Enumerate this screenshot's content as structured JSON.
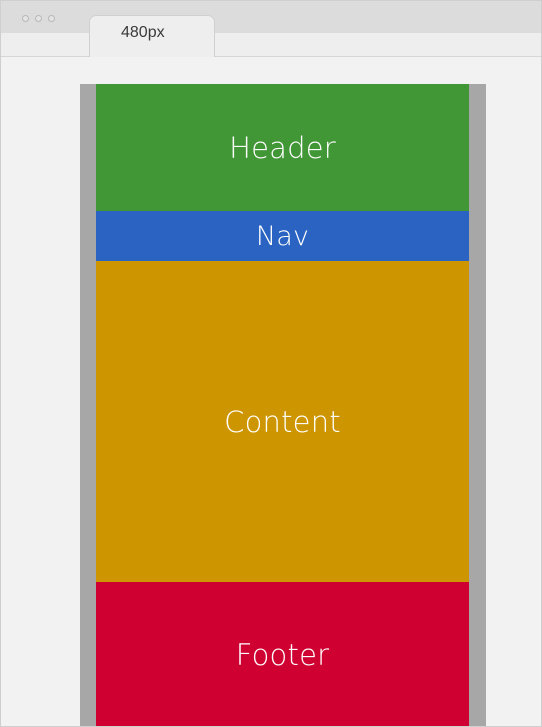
{
  "browser": {
    "tab_label": "480px"
  },
  "layout": {
    "header_label": "Header",
    "nav_label": "Nav",
    "content_label": "Content",
    "footer_label": "Footer"
  },
  "colors": {
    "header": "#419636",
    "nav": "#2a63c2",
    "content": "#cd9600",
    "footer": "#cf0031",
    "page_frame": "#a7a7a7",
    "viewport": "#f2f2f2"
  }
}
